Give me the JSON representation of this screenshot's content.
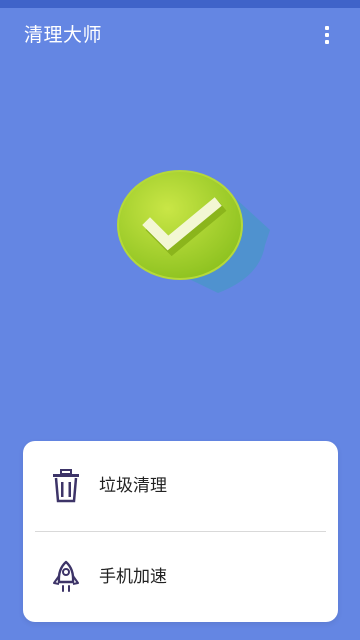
{
  "header": {
    "title": "清理大师",
    "menu_icon": "more-vert-icon"
  },
  "status": {
    "icon": "check-circle-icon",
    "colors": {
      "circle_light": "#c2e23e",
      "circle_dark": "#8dc21f",
      "check": "#f3f7d3",
      "shadow": "#3e9cc0"
    }
  },
  "actions": {
    "items": [
      {
        "label": "垃圾清理",
        "icon": "trash-icon"
      },
      {
        "label": "手机加速",
        "icon": "rocket-icon"
      }
    ]
  },
  "theme": {
    "background": "#6486e3",
    "card": "#ffffff",
    "icon_color": "#3d3468"
  }
}
